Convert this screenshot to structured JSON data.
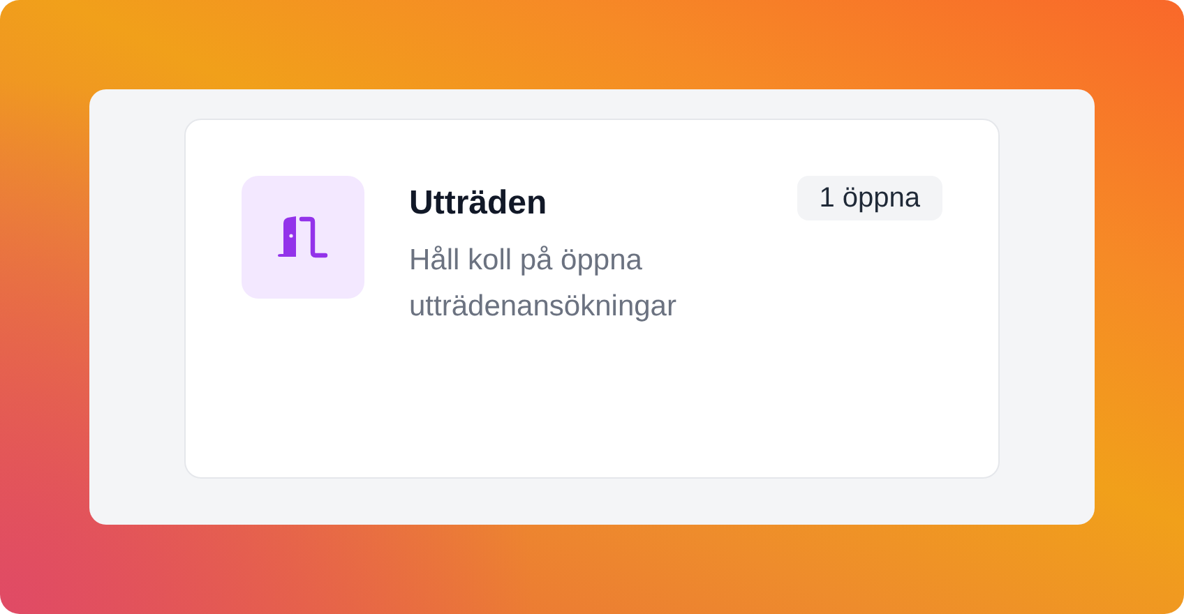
{
  "card": {
    "title": "Utträden",
    "badge": "1 öppna",
    "description": "Håll koll på öppna utträdenansökningar"
  }
}
